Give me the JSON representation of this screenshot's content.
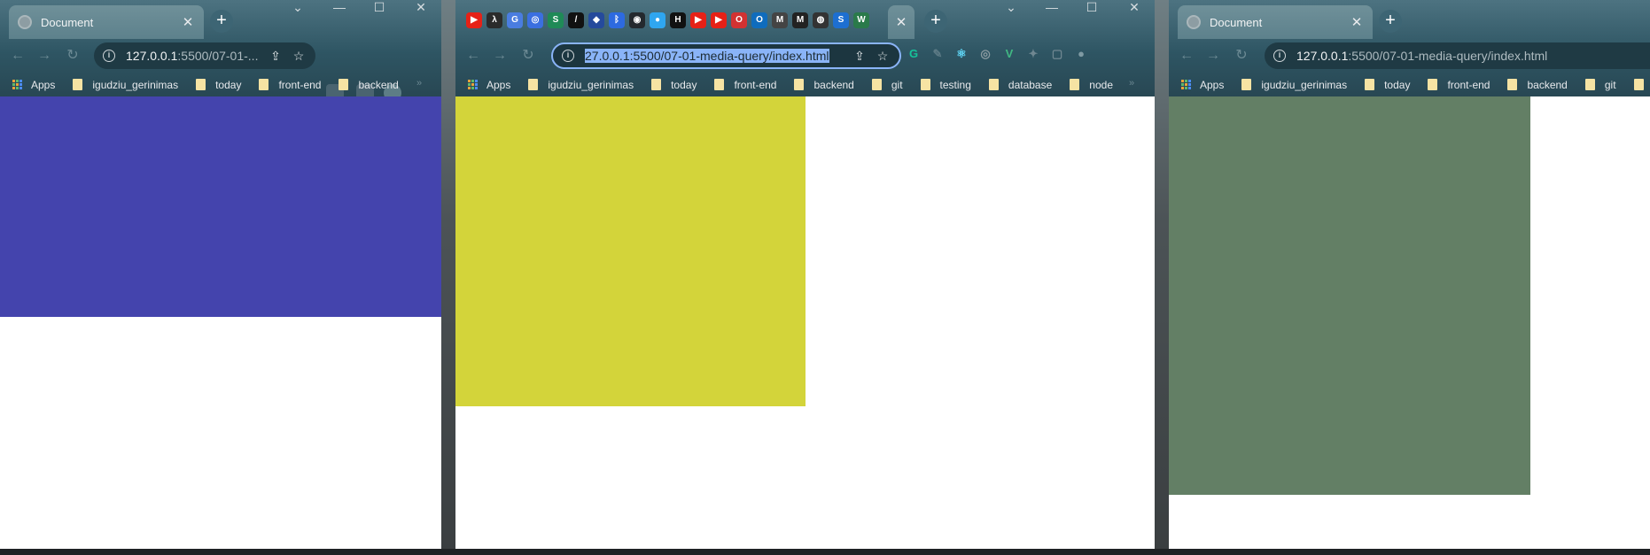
{
  "colors": {
    "left_box": "#4444ad",
    "middle_box": "#d3d43a",
    "right_box": "#637f65",
    "chrome_top": "#4d7381",
    "chrome_bottom": "#284753",
    "url_highlight": "#8ab4f8"
  },
  "left_window": {
    "tab_title": "Document",
    "url_host": "127.0.0.1",
    "url_path": ":5500/07-01-...",
    "bookmarks": [
      "igudziu_gerinimas",
      "today",
      "front-end",
      "backend"
    ],
    "apps_label": "Apps",
    "bookmarks_more": "»"
  },
  "middle_window": {
    "url_selected": "27.0.0.1:5500/07-01-media-query/index.html",
    "bookmarks": [
      "igudziu_gerinimas",
      "today",
      "front-end",
      "backend",
      "git",
      "testing",
      "database",
      "node"
    ],
    "apps_label": "Apps",
    "bookmarks_more": "»",
    "pinned_tab_icons": [
      "youtube-icon",
      "lambda-icon",
      "translate-icon",
      "chrome-icon",
      "s-icon",
      "slash-icon",
      "blue-icon",
      "bluetooth-icon",
      "github-icon",
      "edge-icon",
      "h-icon",
      "youtube-icon",
      "youtube-icon",
      "opera-icon",
      "outlook-icon",
      "gmail-icon",
      "m-icon",
      "bot-icon",
      "s-blue-icon",
      "w-icon"
    ],
    "extensions": [
      "grammarly-icon",
      "pen-icon",
      "react-icon",
      "target-icon",
      "vue-icon",
      "puzzle-icon",
      "square-icon",
      "avatar"
    ]
  },
  "right_window": {
    "tab_title": "Document",
    "url_host": "127.0.0.1",
    "url_path": ":5500/07-01-media-query/index.html",
    "bookmarks": [
      "igudziu_gerinimas",
      "today",
      "front-end",
      "backend",
      "git"
    ],
    "apps_label": "Apps"
  },
  "glyphs": {
    "close": "✕",
    "plus": "+",
    "minimize": "—",
    "maximize": "☐",
    "chevron": "⌄",
    "back": "←",
    "forward": "→",
    "reload": "↻",
    "share": "⇪",
    "star": "☆",
    "info": "i"
  }
}
